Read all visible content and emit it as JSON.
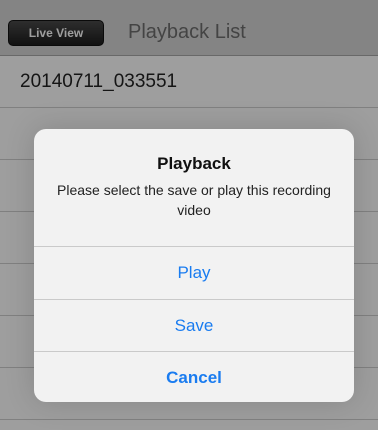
{
  "navbar": {
    "live_view_label": "Live View",
    "title": "Playback List"
  },
  "list": {
    "items": [
      {
        "label": "20140711_033551"
      },
      {
        "label": ""
      },
      {
        "label": ""
      },
      {
        "label": ""
      },
      {
        "label": ""
      },
      {
        "label": ""
      },
      {
        "label": ""
      }
    ]
  },
  "alert": {
    "title": "Playback",
    "message": "Please select the save or play this recording video",
    "buttons": {
      "play": "Play",
      "save": "Save",
      "cancel": "Cancel"
    }
  },
  "colors": {
    "accent": "#1a7cf0",
    "navbar": "#d6d6d6",
    "overlay": "rgba(0,0,0,0.38)"
  }
}
